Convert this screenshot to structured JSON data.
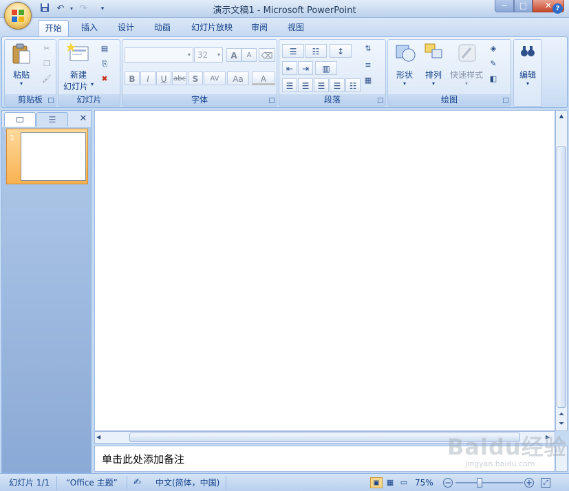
{
  "window": {
    "title": "演示文稿1 - Microsoft PowerPoint",
    "minimize": "─",
    "maximize": "□",
    "close": "✕"
  },
  "quick_access": {
    "save": "save-icon",
    "undo": "undo-icon",
    "redo": "redo-icon",
    "customize": "▾"
  },
  "tabs": [
    {
      "label": "开始",
      "active": true
    },
    {
      "label": "插入"
    },
    {
      "label": "设计"
    },
    {
      "label": "动画"
    },
    {
      "label": "幻灯片放映"
    },
    {
      "label": "审阅"
    },
    {
      "label": "视图"
    }
  ],
  "help": "?",
  "ribbon": {
    "clipboard": {
      "label": "剪贴板",
      "paste": "粘贴"
    },
    "slides": {
      "label": "幻灯片",
      "new_slide_line1": "新建",
      "new_slide_line2": "幻灯片"
    },
    "font": {
      "label": "字体",
      "font_name": "",
      "font_size": "32",
      "bold": "B",
      "italic": "I",
      "underline": "U",
      "strike": "abc",
      "shadow": "S",
      "spacing": "AV",
      "case": "Aa",
      "color": "A",
      "grow": "A",
      "shrink": "A"
    },
    "paragraph": {
      "label": "段落"
    },
    "drawing": {
      "label": "绘图",
      "shapes": "形状",
      "arrange": "排列",
      "quick_styles": "快速样式"
    },
    "editing": {
      "label": "编辑"
    }
  },
  "left_panel": {
    "close": "✕",
    "slide_number": "1"
  },
  "notes_placeholder": "单击此处添加备注",
  "status": {
    "slide": "幻灯片 1/1",
    "theme": "“Office 主题”",
    "language": "中文(简体，中国)",
    "zoom": "75%",
    "zoom_level": 0.75
  },
  "watermark": {
    "text": "Baidu经验",
    "sub": "jingyan.baidu.com"
  },
  "colors": {
    "accent": "#15428b",
    "ribbon_bg": "#d5e4f6",
    "thumb_highlight": "#f8b252"
  }
}
